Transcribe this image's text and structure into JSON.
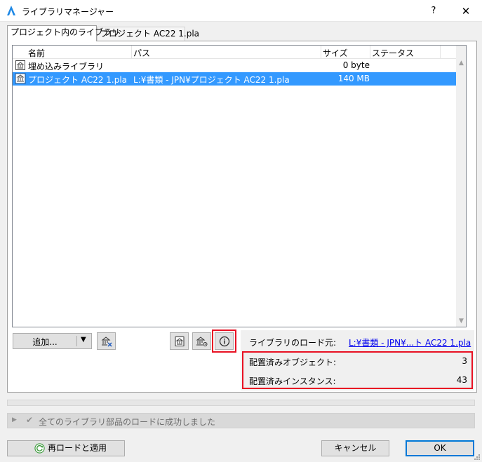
{
  "window": {
    "title": "ライブラリマネージャー",
    "help_label": "?",
    "close_label": "✕"
  },
  "tabs": [
    {
      "label": "プロジェクト内のライブラリ",
      "active": true
    },
    {
      "label": "プロジェクト AC22 1.pla",
      "active": false
    }
  ],
  "list": {
    "columns": [
      "名前",
      "パス",
      "サイズ",
      "ステータス"
    ],
    "rows": [
      {
        "name": "埋め込みライブラリ",
        "path": "",
        "size": "0 byte",
        "status": "",
        "selected": false,
        "icon": "embedded-library-icon"
      },
      {
        "name": "プロジェクト AC22 1.pla",
        "path": "L:¥書類 - JPN¥プロジェクト AC22 1.pla",
        "size": "140 MB",
        "status": "",
        "selected": true,
        "icon": "linked-library-icon"
      }
    ]
  },
  "toolbar": {
    "add_label": "追加...",
    "add_dropdown_icon": "triangle-down-icon",
    "remove_icon": "library-remove-icon",
    "embed_icon": "embed-library-icon",
    "manage_icon": "library-settings-icon",
    "info_icon": "info-icon"
  },
  "details": {
    "source_label": "ライブラリのロード元:",
    "source_value": "L:¥書類 - JPN¥...ト AC22 1.pla",
    "placed_objects_label": "配置済みオブジェクト:",
    "placed_objects_value": "3",
    "placed_instances_label": "配置済みインスタンス:",
    "placed_instances_value": "43"
  },
  "status": {
    "message": "全てのライブラリ部品のロードに成功しました"
  },
  "buttons": {
    "reload_label": "再ロードと適用",
    "cancel_label": "キャンセル",
    "ok_label": "OK"
  },
  "colors": {
    "selection": "#3399ff",
    "highlight": "#e81123",
    "link": "#0000ee"
  }
}
